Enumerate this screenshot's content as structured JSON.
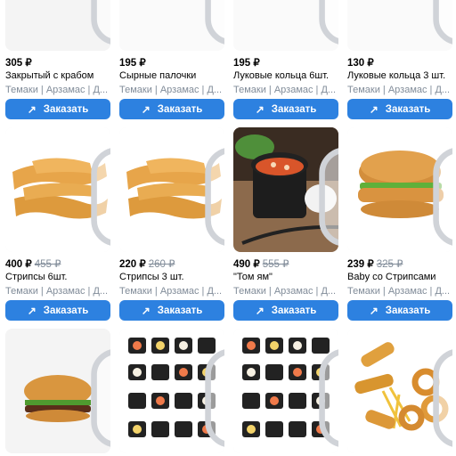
{
  "products": [
    {
      "price": "305 ₽",
      "old_price": "",
      "title": "Закрытый с крабом",
      "subtitle": "Темаки | Арзамас | Д...",
      "button": "Заказать",
      "image": "crab-roll"
    },
    {
      "price": "195 ₽",
      "old_price": "",
      "title": "Сырные палочки",
      "subtitle": "Темаки | Арзамас | Д...",
      "button": "Заказать",
      "image": "cheese-sticks"
    },
    {
      "price": "195 ₽",
      "old_price": "",
      "title": "Луковые кольца 6шт.",
      "subtitle": "Темаки | Арзамас | Д...",
      "button": "Заказать",
      "image": "onion-rings"
    },
    {
      "price": "130 ₽",
      "old_price": "",
      "title": "Луковые кольца 3 шт.",
      "subtitle": "Темаки | Арзамас | Д...",
      "button": "Заказать",
      "image": "onion-rings"
    },
    {
      "price": "400 ₽",
      "old_price": "455 ₽",
      "title": "Стрипсы 6шт.",
      "subtitle": "Темаки | Арзамас | Д...",
      "button": "Заказать",
      "image": "strips"
    },
    {
      "price": "220 ₽",
      "old_price": "260 ₽",
      "title": "Стрипсы 3 шт.",
      "subtitle": "Темаки | Арзамас | Д...",
      "button": "Заказать",
      "image": "strips"
    },
    {
      "price": "490 ₽",
      "old_price": "555 ₽",
      "title": "\"Том ям\"",
      "subtitle": "Темаки | Арзамас | Д...",
      "button": "Заказать",
      "image": "tom-yam"
    },
    {
      "price": "239 ₽",
      "old_price": "325 ₽",
      "title": "Baby со Стрипсами",
      "subtitle": "Темаки | Арзамас | Д...",
      "button": "Заказать",
      "image": "chicken-burger"
    },
    {
      "price": "",
      "old_price": "",
      "title": "",
      "subtitle": "",
      "button": "",
      "image": "burger"
    },
    {
      "price": "",
      "old_price": "",
      "title": "",
      "subtitle": "",
      "button": "",
      "image": "sushi-set"
    },
    {
      "price": "",
      "old_price": "",
      "title": "",
      "subtitle": "",
      "button": "",
      "image": "sushi-set"
    },
    {
      "price": "",
      "old_price": "",
      "title": "",
      "subtitle": "",
      "button": "",
      "image": "fried-mix"
    }
  ],
  "colors": {
    "button": "#2d81e0",
    "muted": "#818c99",
    "image_bg": "#f2f3f5"
  }
}
